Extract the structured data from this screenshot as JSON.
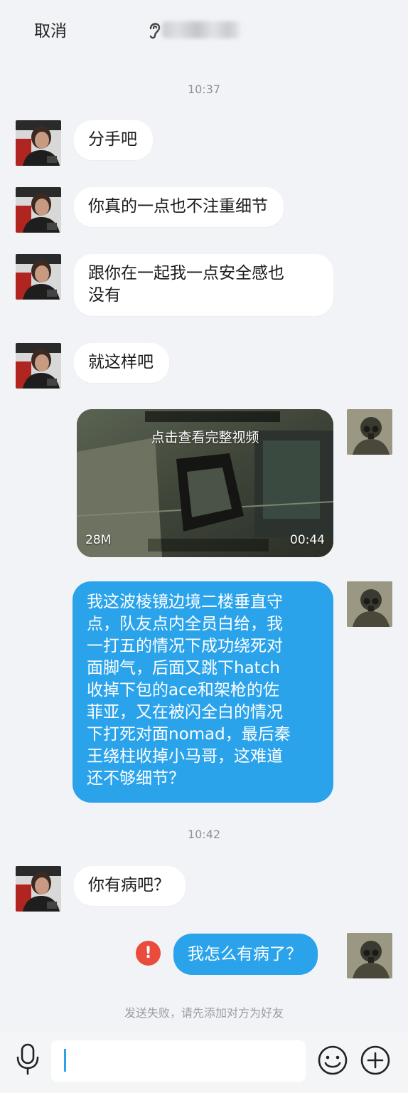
{
  "header": {
    "cancel_label": "取消",
    "contact_name": ""
  },
  "timestamps": [
    "10:37",
    "10:42"
  ],
  "messages": {
    "m1": "分手吧",
    "m2": "你真的一点也不注重细节",
    "m3_line1": "跟你在一起我一点安全感也",
    "m3_line2": "没有",
    "m4": "就这样吧",
    "video": {
      "overlay": "点击查看完整视频",
      "size": "28M",
      "duration": "00:44"
    },
    "m6_lines": [
      "我这波棱镜边境二楼垂直守",
      "点，队友点内全员白给，我",
      "一打五的情况下成功绕死对",
      "面脚气，后面又跳下hatch",
      "收掉下包的ace和架枪的佐",
      "菲亚，又在被闪全白的情况",
      "下打死对面nomad，最后秦",
      "王绕柱收掉小马哥，这难道",
      "还不够细节？"
    ],
    "m7": "你有病吧？",
    "m8": "我怎么有病了？"
  },
  "send_fail": {
    "icon": "!",
    "notice": "发送失败，请先添加对方为好友"
  },
  "input": {
    "value": ""
  },
  "colors": {
    "background": "#f2f3f6",
    "incoming_bubble": "#ffffff",
    "outgoing_bubble": "#2aa3eb",
    "error": "#e94b3c"
  },
  "icons": [
    "ear-icon",
    "mic-icon",
    "emoji-icon",
    "plus-icon",
    "error-icon"
  ]
}
